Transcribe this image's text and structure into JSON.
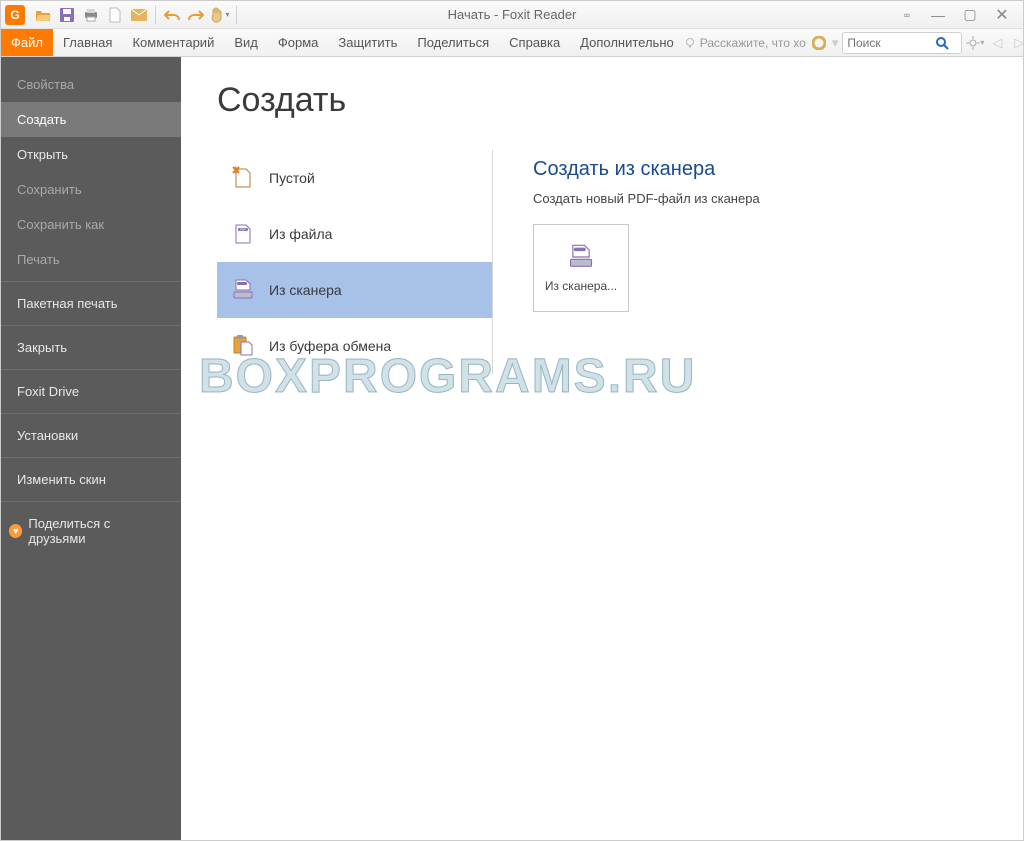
{
  "window_title": "Начать - Foxit Reader",
  "app_initial": "G",
  "ribbon": {
    "tabs": [
      "Файл",
      "Главная",
      "Комментарий",
      "Вид",
      "Форма",
      "Защитить",
      "Поделиться",
      "Справка",
      "Дополнительно"
    ],
    "active_tab": "Файл",
    "tell_me": "Расскажите, что хо",
    "search_placeholder": "Поиск"
  },
  "sidebar": {
    "items": [
      {
        "label": "Свойства",
        "state": "disabled"
      },
      {
        "label": "Создать",
        "state": "selected"
      },
      {
        "label": "Открыть",
        "state": "normal"
      },
      {
        "label": "Сохранить",
        "state": "disabled"
      },
      {
        "label": "Сохранить как",
        "state": "disabled"
      },
      {
        "label": "Печать",
        "state": "disabled"
      },
      {
        "label": "Пакетная печать",
        "state": "normal"
      },
      {
        "label": "Закрыть",
        "state": "normal"
      },
      {
        "label": "Foxit Drive",
        "state": "normal"
      },
      {
        "label": "Установки",
        "state": "normal"
      },
      {
        "label": "Изменить скин",
        "state": "normal"
      }
    ],
    "share_label": "Поделиться с друзьями"
  },
  "content": {
    "heading": "Создать",
    "options": [
      {
        "label": "Пустой",
        "icon": "blank"
      },
      {
        "label": "Из файла",
        "icon": "file"
      },
      {
        "label": "Из сканера",
        "icon": "scanner",
        "selected": true
      },
      {
        "label": "Из буфера обмена",
        "icon": "clipboard"
      }
    ],
    "right": {
      "title": "Создать из сканера",
      "desc": "Создать новый PDF-файл из сканера",
      "tile_label": "Из сканера..."
    }
  },
  "watermark": "BOXPROGRAMS.RU"
}
